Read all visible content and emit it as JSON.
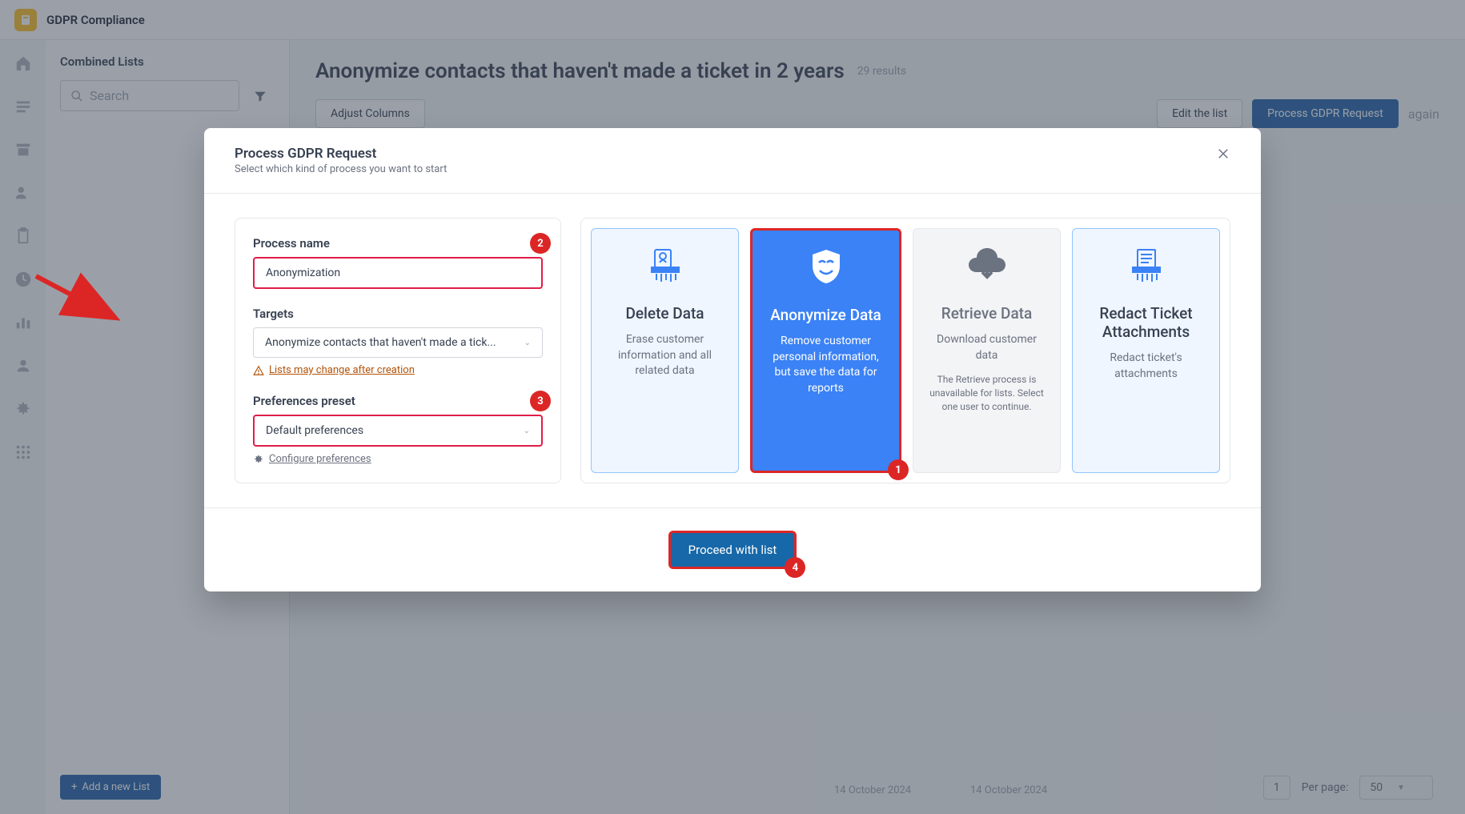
{
  "header": {
    "title": "GDPR Compliance"
  },
  "sidebar": {
    "title": "Combined Lists",
    "search_placeholder": "Search",
    "add_list": "Add a new List"
  },
  "page": {
    "title": "Anonymize contacts that haven't made a ticket in 2 years",
    "result_count": "29 results"
  },
  "toolbar": {
    "adjust": "Adjust Columns",
    "edit": "Edit the list",
    "process": "Process GDPR Request",
    "again": "again"
  },
  "modal": {
    "title": "Process GDPR Request",
    "subtitle": "Select which kind of process you want to start",
    "process_name_label": "Process name",
    "process_name_value": "Anonymization",
    "targets_label": "Targets",
    "targets_value": "Anonymize contacts that haven't made a tick...",
    "targets_warn": "Lists may change after creation",
    "preset_label": "Preferences preset",
    "preset_value": "Default preferences",
    "preset_link": "Configure preferences",
    "proceed": "Proceed with list"
  },
  "options": [
    {
      "title": "Delete Data",
      "desc": "Erase customer information and all related data"
    },
    {
      "title": "Anonymize Data",
      "desc": "Remove customer personal information, but save the data for reports"
    },
    {
      "title": "Retrieve Data",
      "desc": "Download customer data",
      "note": "The Retrieve process is unavailable for lists. Select one user to continue."
    },
    {
      "title": "Redact Ticket Attachments",
      "desc": "Redact ticket's attachments"
    }
  ],
  "badges": {
    "b1": "1",
    "b2": "2",
    "b3": "3",
    "b4": "4"
  },
  "pager": {
    "page": "1",
    "per_label": "Per page:",
    "per_value": "50"
  },
  "date": "14 October 2024"
}
